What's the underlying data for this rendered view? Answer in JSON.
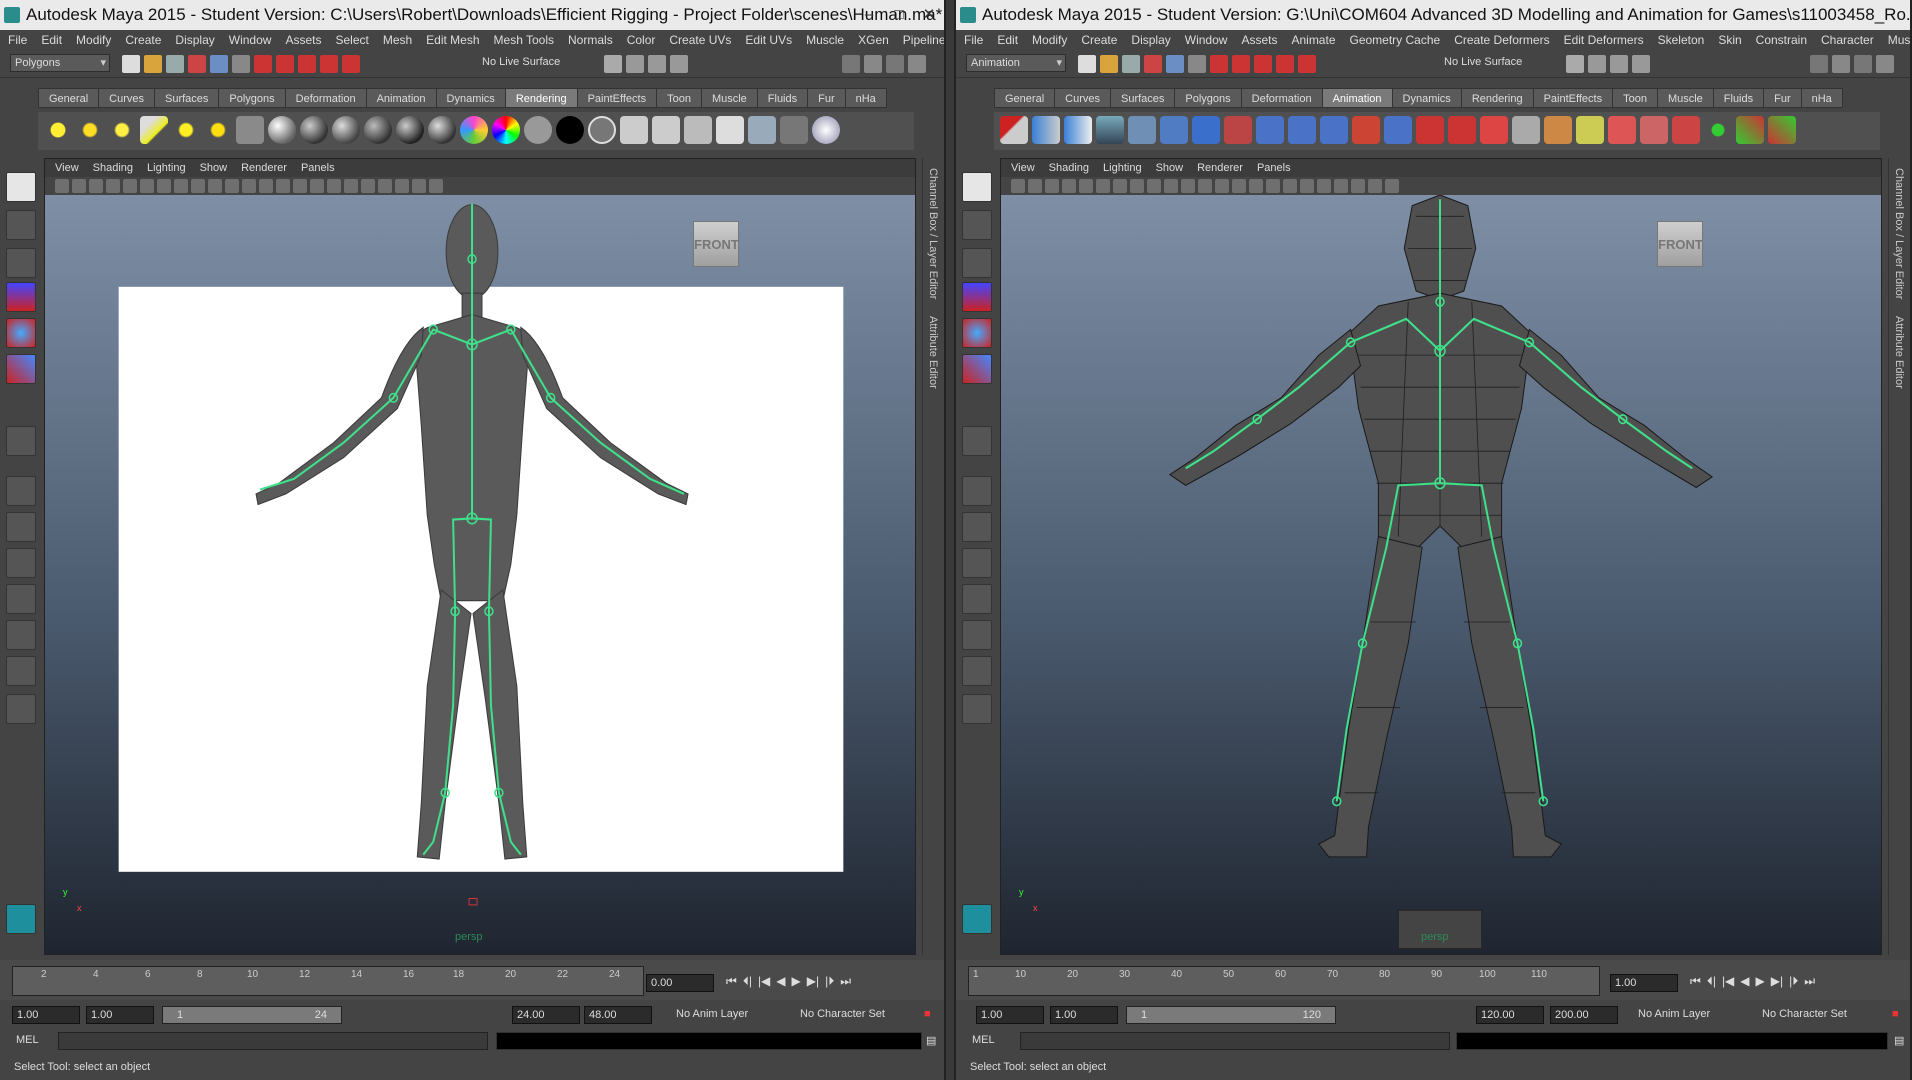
{
  "left": {
    "title": "Autodesk Maya 2015 - Student Version: C:\\Users\\Robert\\Downloads\\Efficient Rigging - Project Folder\\scenes\\Human.ma*  ...",
    "menu": [
      "File",
      "Edit",
      "Modify",
      "Create",
      "Display",
      "Window",
      "Assets",
      "Select",
      "Mesh",
      "Edit Mesh",
      "Mesh Tools",
      "Normals",
      "Color",
      "Create UVs",
      "Edit UVs",
      "Muscle",
      "XGen",
      "Pipeline Cache"
    ],
    "mode": "Polygons",
    "live": "No Live Surface",
    "shelf_tabs": [
      "General",
      "Curves",
      "Surfaces",
      "Polygons",
      "Deformation",
      "Animation",
      "Dynamics",
      "Rendering",
      "PaintEffects",
      "Toon",
      "Muscle",
      "Fluids",
      "Fur",
      "nHa"
    ],
    "active_tab": "Rendering",
    "panel_menu": [
      "View",
      "Shading",
      "Lighting",
      "Show",
      "Renderer",
      "Panels"
    ],
    "camera_label": "persp",
    "view_cube": "FRONT",
    "axis_x": "x",
    "axis_y": "y",
    "ticks": [
      "2",
      "4",
      "6",
      "8",
      "10",
      "12",
      "14",
      "16",
      "18",
      "20",
      "22",
      "24"
    ],
    "current_frame": "0.00",
    "range_start": "1.00",
    "range_start2": "1.00",
    "range_inner_start": "1",
    "range_inner_end": "24",
    "range_end": "24.00",
    "range_end2": "48.00",
    "anim_layer": "No Anim Layer",
    "char_set": "No Character Set",
    "mel_label": "MEL",
    "help": "Select Tool: select an object",
    "side_channel": "Channel Box / Layer Editor",
    "side_attr": "Attribute Editor"
  },
  "right": {
    "title": "Autodesk Maya 2015 - Student Version: G:\\Uni\\COM604 Advanced 3D Modelling and Animation for Games\\s11003458_Ro...",
    "menu": [
      "File",
      "Edit",
      "Modify",
      "Create",
      "Display",
      "Window",
      "Assets",
      "Animate",
      "Geometry Cache",
      "Create Deformers",
      "Edit Deformers",
      "Skeleton",
      "Skin",
      "Constrain",
      "Character",
      "Muscle"
    ],
    "mode": "Animation",
    "live": "No Live Surface",
    "shelf_tabs": [
      "General",
      "Curves",
      "Surfaces",
      "Polygons",
      "Deformation",
      "Animation",
      "Dynamics",
      "Rendering",
      "PaintEffects",
      "Toon",
      "Muscle",
      "Fluids",
      "Fur",
      "nHa"
    ],
    "active_tab": "Animation",
    "panel_menu": [
      "View",
      "Shading",
      "Lighting",
      "Show",
      "Renderer",
      "Panels"
    ],
    "camera_label": "persp",
    "view_cube": "FRONT",
    "axis_x": "x",
    "axis_y": "y",
    "ticks": [
      "1",
      "10",
      "20",
      "30",
      "40",
      "50",
      "60",
      "70",
      "80",
      "90",
      "100",
      "110"
    ],
    "current_frame": "1.00",
    "range_start": "1.00",
    "range_start2": "1.00",
    "range_inner_start": "1",
    "range_inner_end": "120",
    "range_end": "120.00",
    "range_end2": "200.00",
    "anim_layer": "No Anim Layer",
    "char_set": "No Character Set",
    "mel_label": "MEL",
    "help": "Select Tool: select an object",
    "side_channel": "Channel Box / Layer Editor",
    "side_attr": "Attribute Editor"
  },
  "colors": {
    "joint": "#3fe08a",
    "mesh": "#5c5c5c",
    "render_bg": "#ffffff"
  }
}
